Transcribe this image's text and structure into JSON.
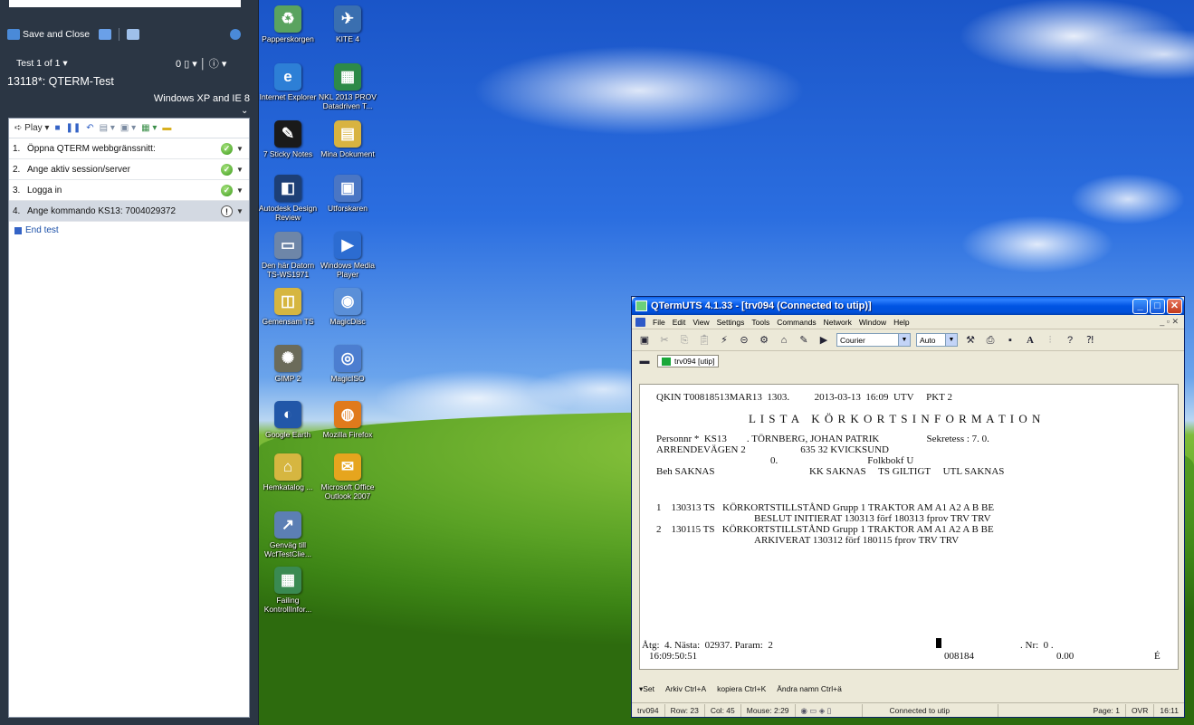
{
  "panel": {
    "save_close": "Save and Close",
    "nav_label": "Test 1 of 1 ▾",
    "attach_count": "0",
    "title": "13118*: QTERM-Test",
    "config": "Windows XP and IE 8",
    "play": "Play",
    "steps": [
      {
        "num": "1.",
        "text": "Öppna QTERM webbgränssnitt:",
        "status": "pass"
      },
      {
        "num": "2.",
        "text": "Ange aktiv session/server",
        "status": "pass"
      },
      {
        "num": "3.",
        "text": "Logga in",
        "status": "pass"
      },
      {
        "num": "4.",
        "text": "Ange kommando KS13: 7004029372",
        "status": "info"
      }
    ],
    "end_test": "End test"
  },
  "desktop": {
    "icons": [
      {
        "label": "Papperskorgen",
        "icon": "recycle-bin-icon",
        "color": "#5aa35f"
      },
      {
        "label": "KITE 4",
        "icon": "kite-icon",
        "color": "#3a6fb0"
      },
      {
        "label": "Internet Explorer",
        "icon": "internet-explorer-icon",
        "color": "#2d7fd6"
      },
      {
        "label": "NKL 2013 PROV Datadriven T...",
        "icon": "excel-file-icon",
        "color": "#2d8a48"
      },
      {
        "label": "7 Sticky Notes",
        "icon": "sticky-notes-icon",
        "color": "#1a1a1a"
      },
      {
        "label": "Mina Dokument",
        "icon": "documents-icon",
        "color": "#d8b340"
      },
      {
        "label": "Autodesk Design Review",
        "icon": "autodesk-icon",
        "color": "#1d3f76"
      },
      {
        "label": "Utforskaren",
        "icon": "explorer-icon",
        "color": "#4a76c4"
      },
      {
        "label": "Den här Datorn TS-WS1971",
        "icon": "computer-icon",
        "color": "#6e86a8"
      },
      {
        "label": "Windows Media Player",
        "icon": "media-player-icon",
        "color": "#2c6cd1"
      },
      {
        "label": "Gemensam TS",
        "icon": "network-folder-icon",
        "color": "#d6b640"
      },
      {
        "label": "MagicDisc",
        "icon": "magicdisc-icon",
        "color": "#5a8fd8"
      },
      {
        "label": "GIMP 2",
        "icon": "gimp-icon",
        "color": "#6b6b5a"
      },
      {
        "label": "MagicISO",
        "icon": "magiciso-icon",
        "color": "#4c7ed0"
      },
      {
        "label": "Google Earth",
        "icon": "google-earth-icon",
        "color": "#2257a8"
      },
      {
        "label": "Mozilla Firefox",
        "icon": "firefox-icon",
        "color": "#e07a1c"
      },
      {
        "label": "Hemkatalog ...",
        "icon": "home-folder-icon",
        "color": "#d6b640"
      },
      {
        "label": "Microsoft Office Outlook 2007",
        "icon": "outlook-icon",
        "color": "#e6a51e"
      },
      {
        "label": "Genväg till WcfTestClie...",
        "icon": "shortcut-icon",
        "color": "#5c7fb4"
      },
      {
        "label": "Failing KontrollInfor...",
        "icon": "failing-file-icon",
        "color": "#3a8a52"
      }
    ]
  },
  "qterm": {
    "title": "QTermUTS 4.1.33 - [trv094 (Connected to utip)]",
    "menu": [
      "File",
      "Edit",
      "View",
      "Settings",
      "Tools",
      "Commands",
      "Network",
      "Window",
      "Help"
    ],
    "font_combo": "Courier",
    "size_combo": "Auto",
    "session_tab": "trv094 [utip]",
    "screen_lines": [
      "QKIN T00818513MAR13  1303.          2013-03-13  16:09  UTV     PKT 2",
      "L I S T A   K Ö R K O R T S I N F O R M A T I O N",
      "Personnr *  KS13        . TÖRNBERG, JOHAN PATRIK                   Sekretess : 7. 0.",
      "ARRENDEVÄGEN 2                      635 32 KVICKSUND",
      "0.                                    Folkbokf U",
      "Beh SAKNAS                                      KK SAKNAS     TS GILTIGT     UTL SAKNAS",
      "1    130313 TS   KÖRKORTSTILLSTÅND Grupp 1 TRAKTOR AM A1 A2 A B BE",
      "BESLUT INITIERAT 130313 förf 180313 fprov TRV TRV",
      "2    130115 TS   KÖRKORTSTILLSTÅND Grupp 1 TRAKTOR AM A1 A2 A B BE",
      "ARKIVERAT 130312 förf 180115 fprov TRV TRV",
      "Åtg:  4. Nästa:  02937. Param:  2",
      ". Nr:  0 .",
      "16:09:50:51",
      "008184",
      "0.00",
      "É"
    ],
    "keys": [
      "▾Set",
      "Arkiv Ctrl+A",
      "kopiera Ctrl+K",
      "Ändra namn Ctrl+ä"
    ],
    "status": {
      "session": "trv094",
      "row": "Row: 23",
      "col": "Col: 45",
      "mouse": "Mouse: 2:29",
      "connection": "Connected to utip",
      "page": "Page: 1",
      "mode": "OVR",
      "time": "16:11"
    }
  }
}
